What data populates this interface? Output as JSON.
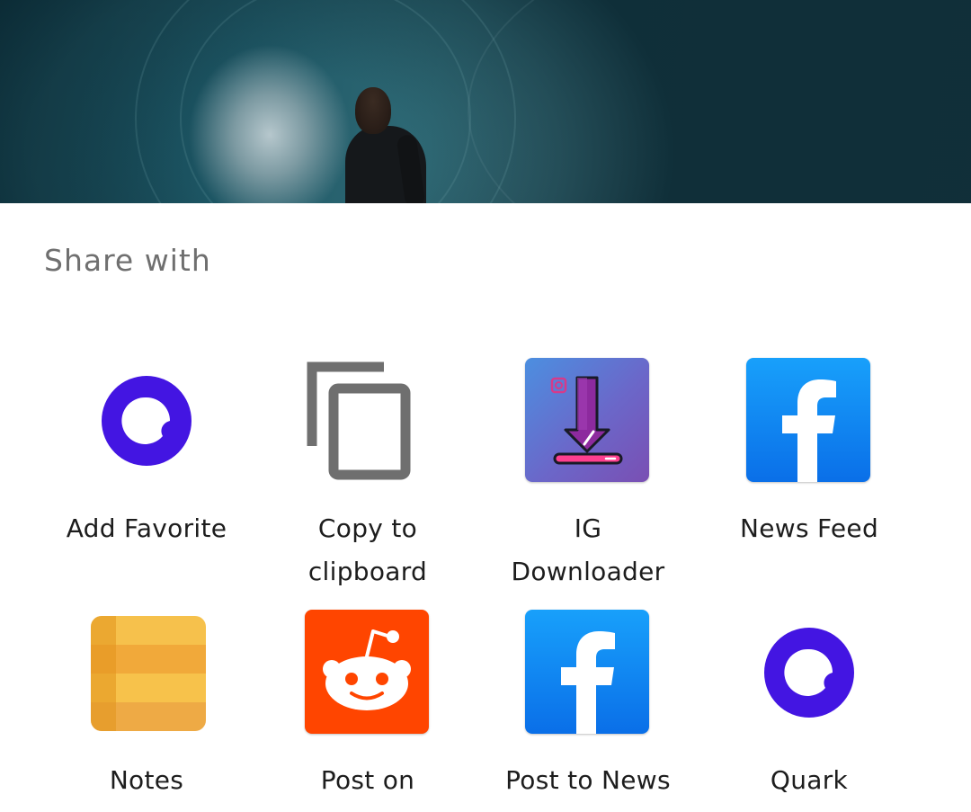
{
  "sheet": {
    "title": "Share with"
  },
  "items": [
    {
      "label": "Add Favorite",
      "icon": "quark-circle-icon"
    },
    {
      "label": "Copy to clipboard",
      "icon": "copy-icon"
    },
    {
      "label": "IG Downloader",
      "icon": "ig-downloader-icon"
    },
    {
      "label": "News Feed",
      "icon": "facebook-icon"
    },
    {
      "label": "Notes",
      "icon": "notes-icon"
    },
    {
      "label": "Post on Reddit",
      "icon": "reddit-icon"
    },
    {
      "label": "Post to News Feed",
      "icon": "facebook-icon"
    },
    {
      "label": "Quark Download",
      "icon": "quark-circle-icon"
    }
  ],
  "colors": {
    "quark_purple": "#4315e2",
    "facebook_blue": "#0a7cf0",
    "reddit_orange": "#ff4500",
    "notes_yellow": "#f4b53c",
    "copy_gray": "#6f6f6f"
  }
}
